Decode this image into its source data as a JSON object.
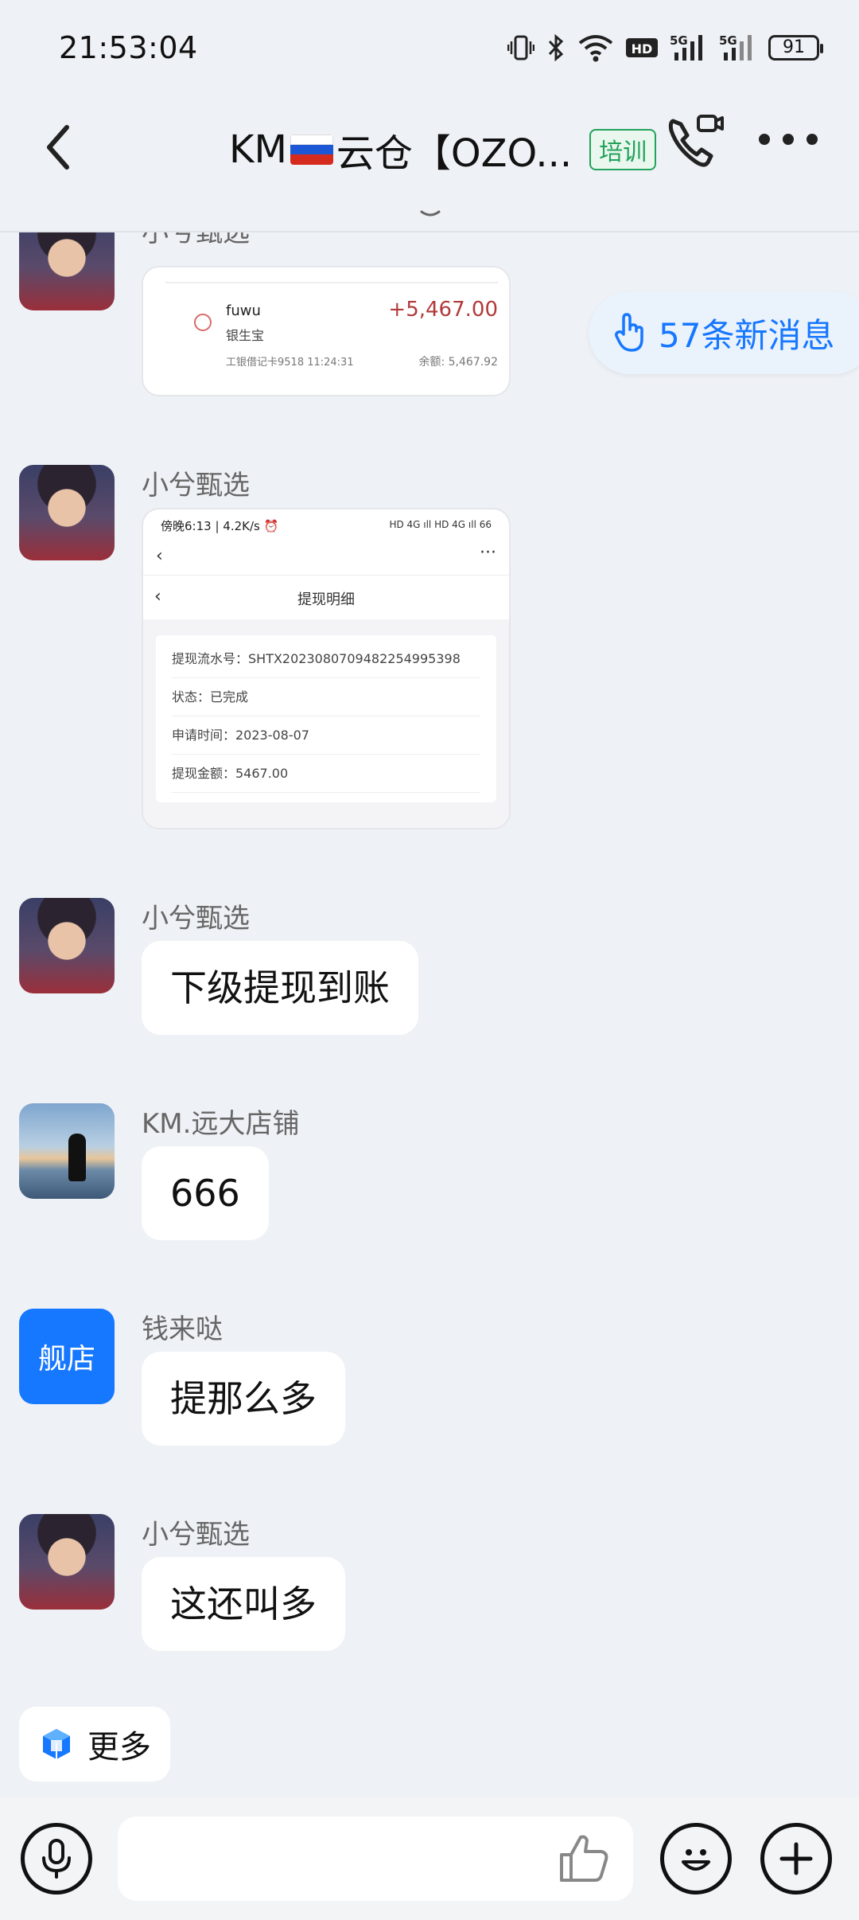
{
  "status_bar": {
    "time": "21:53:04",
    "battery": "91",
    "icons": [
      "vibrate-icon",
      "bluetooth-icon",
      "wifi-icon",
      "hd-icon",
      "5g-signal-icon",
      "5g-signal-icon",
      "battery-icon"
    ]
  },
  "header": {
    "title_prefix": "KM",
    "title_suffix": "云仓【OZO...",
    "tag": "培训",
    "colors": {
      "tag": "#22a25a",
      "accent": "#1677ff"
    }
  },
  "new_messages": {
    "label": "57条新消息"
  },
  "messages": [
    {
      "sender": "小兮甄选",
      "type": "image",
      "bank": {
        "name": "fuwu",
        "sub": "银生宝",
        "card": "工银借记卡9518  11:24:31",
        "amount": "+5,467.00",
        "balance": "余额: 5,467.92"
      }
    },
    {
      "sender": "小兮甄选",
      "type": "image",
      "screenshot": {
        "status_left": "傍晚6:13 | 4.2K/s ⏰",
        "status_right": "HD 4G ıll HD 4G ıll 66",
        "title": "提现明细",
        "rows": [
          "提现流水号：SHTX2023080709482254995398",
          "状态：已完成",
          "申请时间：2023-08-07",
          "提现金额：5467.00"
        ]
      }
    },
    {
      "sender": "小兮甄选",
      "type": "text",
      "text": "下级提现到账"
    },
    {
      "sender": "KM.远大店铺",
      "type": "text",
      "text": "666"
    },
    {
      "sender": "钱来哒",
      "type": "text",
      "text": "提那么多",
      "avatar_text": "舰店"
    },
    {
      "sender": "小兮甄选",
      "type": "text",
      "text": "这还叫多"
    }
  ],
  "more_chip": {
    "label": "更多"
  },
  "input": {
    "value": "",
    "placeholder": ""
  }
}
